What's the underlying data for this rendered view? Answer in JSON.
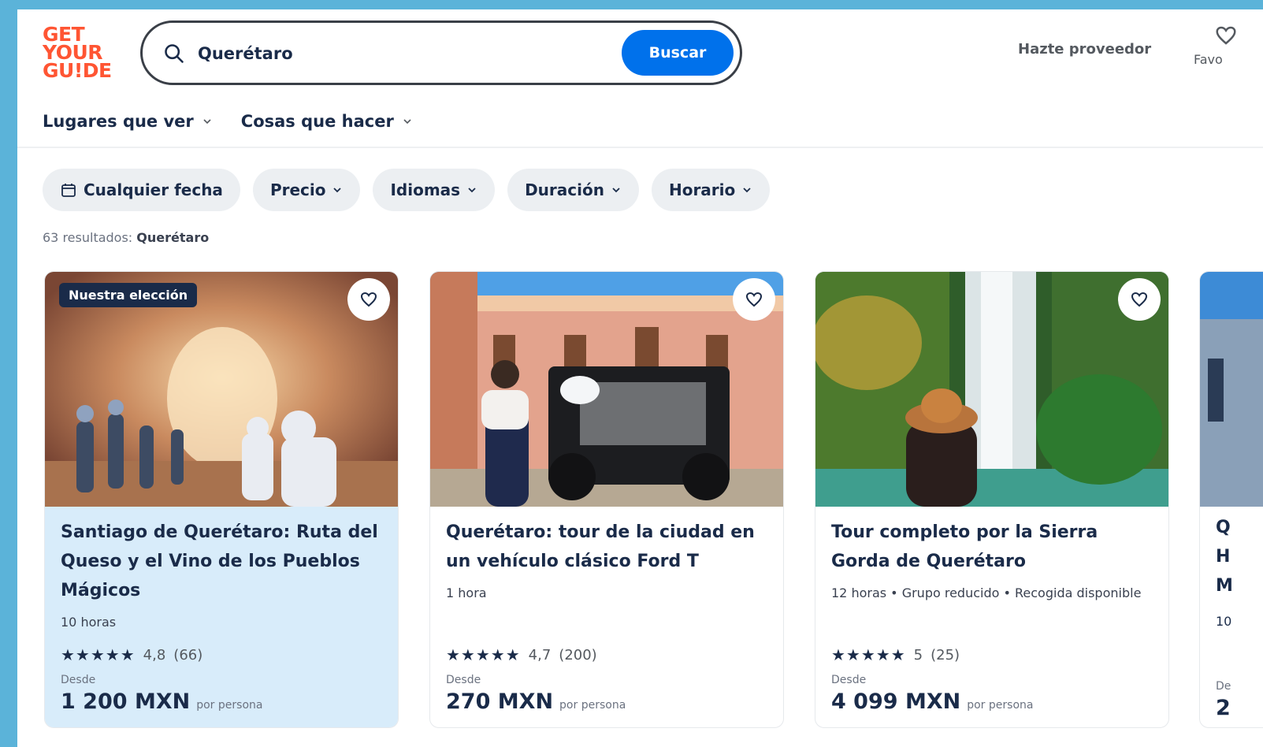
{
  "header": {
    "logo": [
      "GET",
      "YOUR",
      "GU!DE"
    ],
    "search_value": "Querétaro",
    "search_button": "Buscar",
    "provider_link": "Hazte proveedor",
    "favorites_label": "Favo"
  },
  "nav": {
    "items": [
      {
        "label": "Lugares que ver"
      },
      {
        "label": "Cosas que hacer"
      }
    ]
  },
  "filters": {
    "chips": [
      {
        "label": "Cualquier fecha",
        "icon": "calendar-icon"
      },
      {
        "label": "Precio"
      },
      {
        "label": "Idiomas"
      },
      {
        "label": "Duración"
      },
      {
        "label": "Horario"
      }
    ]
  },
  "results": {
    "count_text": "63 resultados:",
    "query": "Querétaro"
  },
  "cards": [
    {
      "badge": "Nuestra elección",
      "title": "Santiago de Querétaro: Ruta del Queso y el Vino de los Pueblos Mágicos",
      "meta": "10 horas",
      "stars": "★★★★★",
      "rating": "4,8",
      "reviews": "(66)",
      "from": "Desde",
      "price": "1 200 MXN",
      "per": "por persona"
    },
    {
      "title": "Querétaro: tour de la ciudad en un vehículo clásico Ford T",
      "meta": "1 hora",
      "stars": "★★★★★",
      "rating": "4,7",
      "reviews": "(200)",
      "from": "Desde",
      "price": "270 MXN",
      "per": "por persona"
    },
    {
      "title": "Tour completo por la Sierra Gorda de Querétaro",
      "meta": "12 horas • Grupo reducido • Recogida disponible",
      "stars": "★★★★★",
      "rating": "5",
      "reviews": "(25)",
      "from": "Desde",
      "price": "4 099 MXN",
      "per": "por persona"
    }
  ],
  "peek": {
    "lines": [
      "Q",
      "H",
      "M"
    ],
    "meta": "10",
    "from": "De",
    "price": "2"
  },
  "colors": {
    "brand": "#ff5533",
    "primary": "#0071eb",
    "text": "#1a2b49",
    "highlight": "#d8ecfa"
  }
}
